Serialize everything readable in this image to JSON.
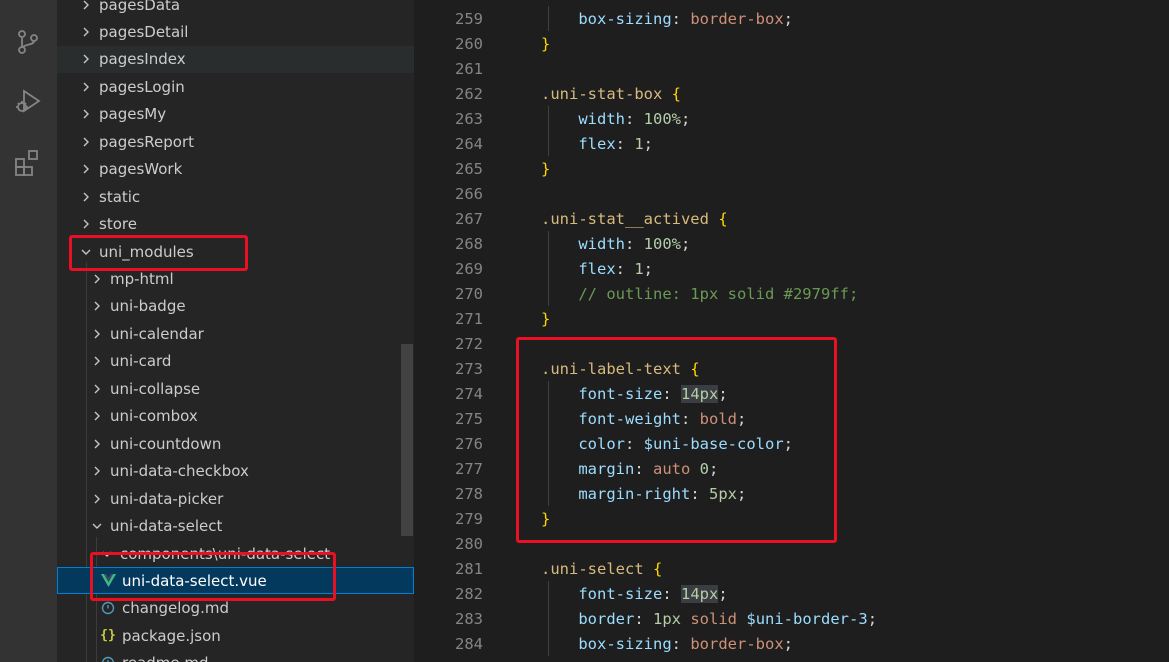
{
  "activity_bar": {
    "icons": [
      "source-control-icon",
      "run-debug-icon",
      "extensions-icon"
    ]
  },
  "explorer": {
    "items": [
      {
        "label": "pagesData",
        "type": "folder",
        "expanded": false
      },
      {
        "label": "pagesDetail",
        "type": "folder",
        "expanded": false
      },
      {
        "label": "pagesIndex",
        "type": "folder",
        "expanded": false
      },
      {
        "label": "pagesLogin",
        "type": "folder",
        "expanded": false
      },
      {
        "label": "pagesMy",
        "type": "folder",
        "expanded": false
      },
      {
        "label": "pagesReport",
        "type": "folder",
        "expanded": false
      },
      {
        "label": "pagesWork",
        "type": "folder",
        "expanded": false
      },
      {
        "label": "static",
        "type": "folder",
        "expanded": false
      },
      {
        "label": "store",
        "type": "folder",
        "expanded": false
      },
      {
        "label": "uni_modules",
        "type": "folder",
        "expanded": true
      },
      {
        "label": "mp-html",
        "type": "folder",
        "expanded": false
      },
      {
        "label": "uni-badge",
        "type": "folder",
        "expanded": false
      },
      {
        "label": "uni-calendar",
        "type": "folder",
        "expanded": false
      },
      {
        "label": "uni-card",
        "type": "folder",
        "expanded": false
      },
      {
        "label": "uni-collapse",
        "type": "folder",
        "expanded": false
      },
      {
        "label": "uni-combox",
        "type": "folder",
        "expanded": false
      },
      {
        "label": "uni-countdown",
        "type": "folder",
        "expanded": false
      },
      {
        "label": "uni-data-checkbox",
        "type": "folder",
        "expanded": false
      },
      {
        "label": "uni-data-picker",
        "type": "folder",
        "expanded": false
      },
      {
        "label": "uni-data-select",
        "type": "folder",
        "expanded": true
      },
      {
        "label": "components\\uni-data-select",
        "type": "folder",
        "expanded": true
      },
      {
        "label": "uni-data-select.vue",
        "type": "vue-file",
        "selected": true
      },
      {
        "label": "changelog.md",
        "type": "md-file"
      },
      {
        "label": "package.json",
        "type": "json-file"
      },
      {
        "label": "readme.md",
        "type": "md-file"
      }
    ]
  },
  "editor": {
    "lines": [
      {
        "n": "259",
        "tokens": [
          [
            "    ",
            ""
          ],
          [
            "box-sizing",
            "prop"
          ],
          [
            ": ",
            "punc"
          ],
          [
            "border-box",
            "val"
          ],
          [
            ";",
            "punc"
          ]
        ],
        "guide": true
      },
      {
        "n": "260",
        "tokens": [
          [
            "}",
            "brace"
          ]
        ]
      },
      {
        "n": "261",
        "tokens": []
      },
      {
        "n": "262",
        "tokens": [
          [
            ".uni-stat-box",
            "sel"
          ],
          [
            " ",
            ""
          ],
          [
            "{",
            "brace"
          ]
        ]
      },
      {
        "n": "263",
        "tokens": [
          [
            "    ",
            ""
          ],
          [
            "width",
            "prop"
          ],
          [
            ": ",
            "punc"
          ],
          [
            "100%",
            "num"
          ],
          [
            ";",
            "punc"
          ]
        ],
        "guide": true
      },
      {
        "n": "264",
        "tokens": [
          [
            "    ",
            ""
          ],
          [
            "flex",
            "prop"
          ],
          [
            ": ",
            "punc"
          ],
          [
            "1",
            "num"
          ],
          [
            ";",
            "punc"
          ]
        ],
        "guide": true
      },
      {
        "n": "265",
        "tokens": [
          [
            "}",
            "brace"
          ]
        ]
      },
      {
        "n": "266",
        "tokens": []
      },
      {
        "n": "267",
        "tokens": [
          [
            ".uni-stat__actived",
            "sel"
          ],
          [
            " ",
            ""
          ],
          [
            "{",
            "brace"
          ]
        ]
      },
      {
        "n": "268",
        "tokens": [
          [
            "    ",
            ""
          ],
          [
            "width",
            "prop"
          ],
          [
            ": ",
            "punc"
          ],
          [
            "100%",
            "num"
          ],
          [
            ";",
            "punc"
          ]
        ],
        "guide": true
      },
      {
        "n": "269",
        "tokens": [
          [
            "    ",
            ""
          ],
          [
            "flex",
            "prop"
          ],
          [
            ": ",
            "punc"
          ],
          [
            "1",
            "num"
          ],
          [
            ";",
            "punc"
          ]
        ],
        "guide": true
      },
      {
        "n": "270",
        "tokens": [
          [
            "    ",
            ""
          ],
          [
            "// outline: 1px solid #2979ff;",
            "cmt"
          ]
        ],
        "guide": true
      },
      {
        "n": "271",
        "tokens": [
          [
            "}",
            "brace"
          ]
        ]
      },
      {
        "n": "272",
        "tokens": []
      },
      {
        "n": "273",
        "tokens": [
          [
            ".uni-label-text",
            "sel"
          ],
          [
            " ",
            ""
          ],
          [
            "{",
            "brace"
          ]
        ]
      },
      {
        "n": "274",
        "tokens": [
          [
            "    ",
            ""
          ],
          [
            "font-size",
            "prop"
          ],
          [
            ": ",
            "punc"
          ],
          [
            "14px",
            "num hl"
          ],
          [
            ";",
            "punc"
          ]
        ],
        "guide": true
      },
      {
        "n": "275",
        "tokens": [
          [
            "    ",
            ""
          ],
          [
            "font-weight",
            "prop"
          ],
          [
            ": ",
            "punc"
          ],
          [
            "bold",
            "val"
          ],
          [
            ";",
            "punc"
          ]
        ],
        "guide": true
      },
      {
        "n": "276",
        "tokens": [
          [
            "    ",
            ""
          ],
          [
            "color",
            "prop"
          ],
          [
            ": ",
            "punc"
          ],
          [
            "$uni-base-color",
            "prop"
          ],
          [
            ";",
            "punc"
          ]
        ],
        "guide": true
      },
      {
        "n": "277",
        "tokens": [
          [
            "    ",
            ""
          ],
          [
            "margin",
            "prop"
          ],
          [
            ": ",
            "punc"
          ],
          [
            "auto",
            "val"
          ],
          [
            " ",
            ""
          ],
          [
            "0",
            "num"
          ],
          [
            ";",
            "punc"
          ]
        ],
        "guide": true
      },
      {
        "n": "278",
        "tokens": [
          [
            "    ",
            ""
          ],
          [
            "margin-right",
            "prop"
          ],
          [
            ": ",
            "punc"
          ],
          [
            "5px",
            "num"
          ],
          [
            ";",
            "punc"
          ]
        ],
        "guide": true
      },
      {
        "n": "279",
        "tokens": [
          [
            "}",
            "brace"
          ]
        ]
      },
      {
        "n": "280",
        "tokens": []
      },
      {
        "n": "281",
        "tokens": [
          [
            ".uni-select",
            "sel"
          ],
          [
            " ",
            ""
          ],
          [
            "{",
            "brace"
          ]
        ]
      },
      {
        "n": "282",
        "tokens": [
          [
            "    ",
            ""
          ],
          [
            "font-size",
            "prop"
          ],
          [
            ": ",
            "punc"
          ],
          [
            "14px",
            "num hl"
          ],
          [
            ";",
            "punc"
          ]
        ],
        "guide": true
      },
      {
        "n": "283",
        "tokens": [
          [
            "    ",
            ""
          ],
          [
            "border",
            "prop"
          ],
          [
            ": ",
            "punc"
          ],
          [
            "1px",
            "num"
          ],
          [
            " ",
            ""
          ],
          [
            "solid",
            "val"
          ],
          [
            " ",
            ""
          ],
          [
            "$uni-border-3",
            "prop"
          ],
          [
            ";",
            "punc"
          ]
        ],
        "guide": true
      },
      {
        "n": "284",
        "tokens": [
          [
            "    ",
            ""
          ],
          [
            "box-sizing",
            "prop"
          ],
          [
            ": ",
            "punc"
          ],
          [
            "border-box",
            "val"
          ],
          [
            ";",
            "punc"
          ]
        ],
        "guide": true
      }
    ]
  },
  "colors": {
    "annotation": "#e81123",
    "selection": "#04395e",
    "vue_icon": "#41b883"
  }
}
